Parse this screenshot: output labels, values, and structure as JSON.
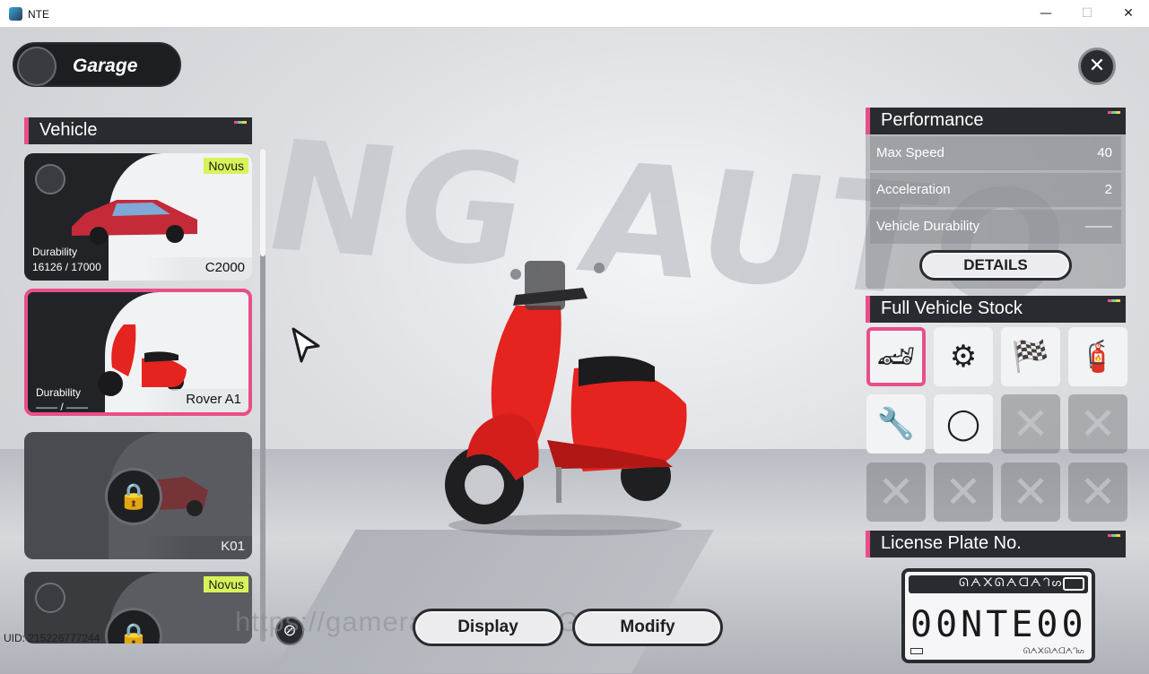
{
  "window": {
    "title": "NTE",
    "min_glyph": "—",
    "max_glyph": "☐",
    "close_glyph": "✕"
  },
  "background": {
    "sign_text": "NG AUTO",
    "sign_text_left": "I"
  },
  "header": {
    "title": "Garage",
    "close_glyph": "✕"
  },
  "vehicle_list": {
    "title": "Vehicle",
    "items": [
      {
        "name": "C2000",
        "faction": "Novus",
        "durability_label": "Durability",
        "durability_value": "16126 / 17000",
        "locked": false,
        "selected": false
      },
      {
        "name": "Rover A1",
        "faction": "",
        "durability_label": "Durability",
        "durability_value": "—— / ——",
        "locked": false,
        "selected": true
      },
      {
        "name": "K01",
        "faction": "",
        "durability_label": "",
        "durability_value": "",
        "locked": true,
        "selected": false
      },
      {
        "name": "",
        "faction": "Novus",
        "durability_label": "",
        "durability_value": "",
        "locked": true,
        "selected": false
      }
    ],
    "lock_glyph": "🔒"
  },
  "actions": {
    "display_label": "Display",
    "modify_label": "Modify",
    "hide_glyph": "⊘"
  },
  "watermark": "https://gamerant.com/... GameNews",
  "uid": "UID: 215226777244",
  "performance": {
    "title": "Performance",
    "stats": [
      {
        "label": "Max Speed",
        "value": "40"
      },
      {
        "label": "Acceleration",
        "value": "2"
      },
      {
        "label": "Vehicle Durability",
        "value": "——"
      }
    ],
    "details_label": "DETAILS"
  },
  "stock": {
    "title": "Full Vehicle Stock",
    "slots": [
      {
        "icon": "🏎",
        "name": "car-body-icon",
        "empty": false,
        "selected": true
      },
      {
        "icon": "⚙",
        "name": "wheel-rim-icon",
        "empty": false,
        "selected": false
      },
      {
        "icon": "🏁",
        "name": "checkered-flag-icon",
        "empty": false,
        "selected": false
      },
      {
        "icon": "🧯",
        "name": "spray-can-icon",
        "empty": false,
        "selected": false
      },
      {
        "icon": "🔧",
        "name": "pistons-icon",
        "empty": false,
        "selected": false
      },
      {
        "icon": "◯",
        "name": "tire-icon",
        "empty": false,
        "selected": false
      },
      {
        "icon": "✕",
        "name": "empty-slot-icon",
        "empty": true,
        "selected": false
      },
      {
        "icon": "✕",
        "name": "empty-slot-icon",
        "empty": true,
        "selected": false
      },
      {
        "icon": "✕",
        "name": "empty-slot-icon",
        "empty": true,
        "selected": false
      },
      {
        "icon": "✕",
        "name": "empty-slot-icon",
        "empty": true,
        "selected": false
      },
      {
        "icon": "✕",
        "name": "empty-slot-icon",
        "empty": true,
        "selected": false
      },
      {
        "icon": "✕",
        "name": "empty-slot-icon",
        "empty": true,
        "selected": false
      }
    ]
  },
  "license_plate": {
    "title": "License Plate No.",
    "script_top": "ᘏᗅ᙭ᘏᗅᗡᗅᒉᔕ",
    "number": "00NTE00",
    "script_bottom": "ᘏᗅ᙭ᘏᗅᗡᗅᒉᔕ"
  },
  "colors": {
    "accent": "#e84f8a",
    "faction": "#d8f35a",
    "scooter": "#e5231f",
    "panel_dark": "#2a2b30"
  }
}
